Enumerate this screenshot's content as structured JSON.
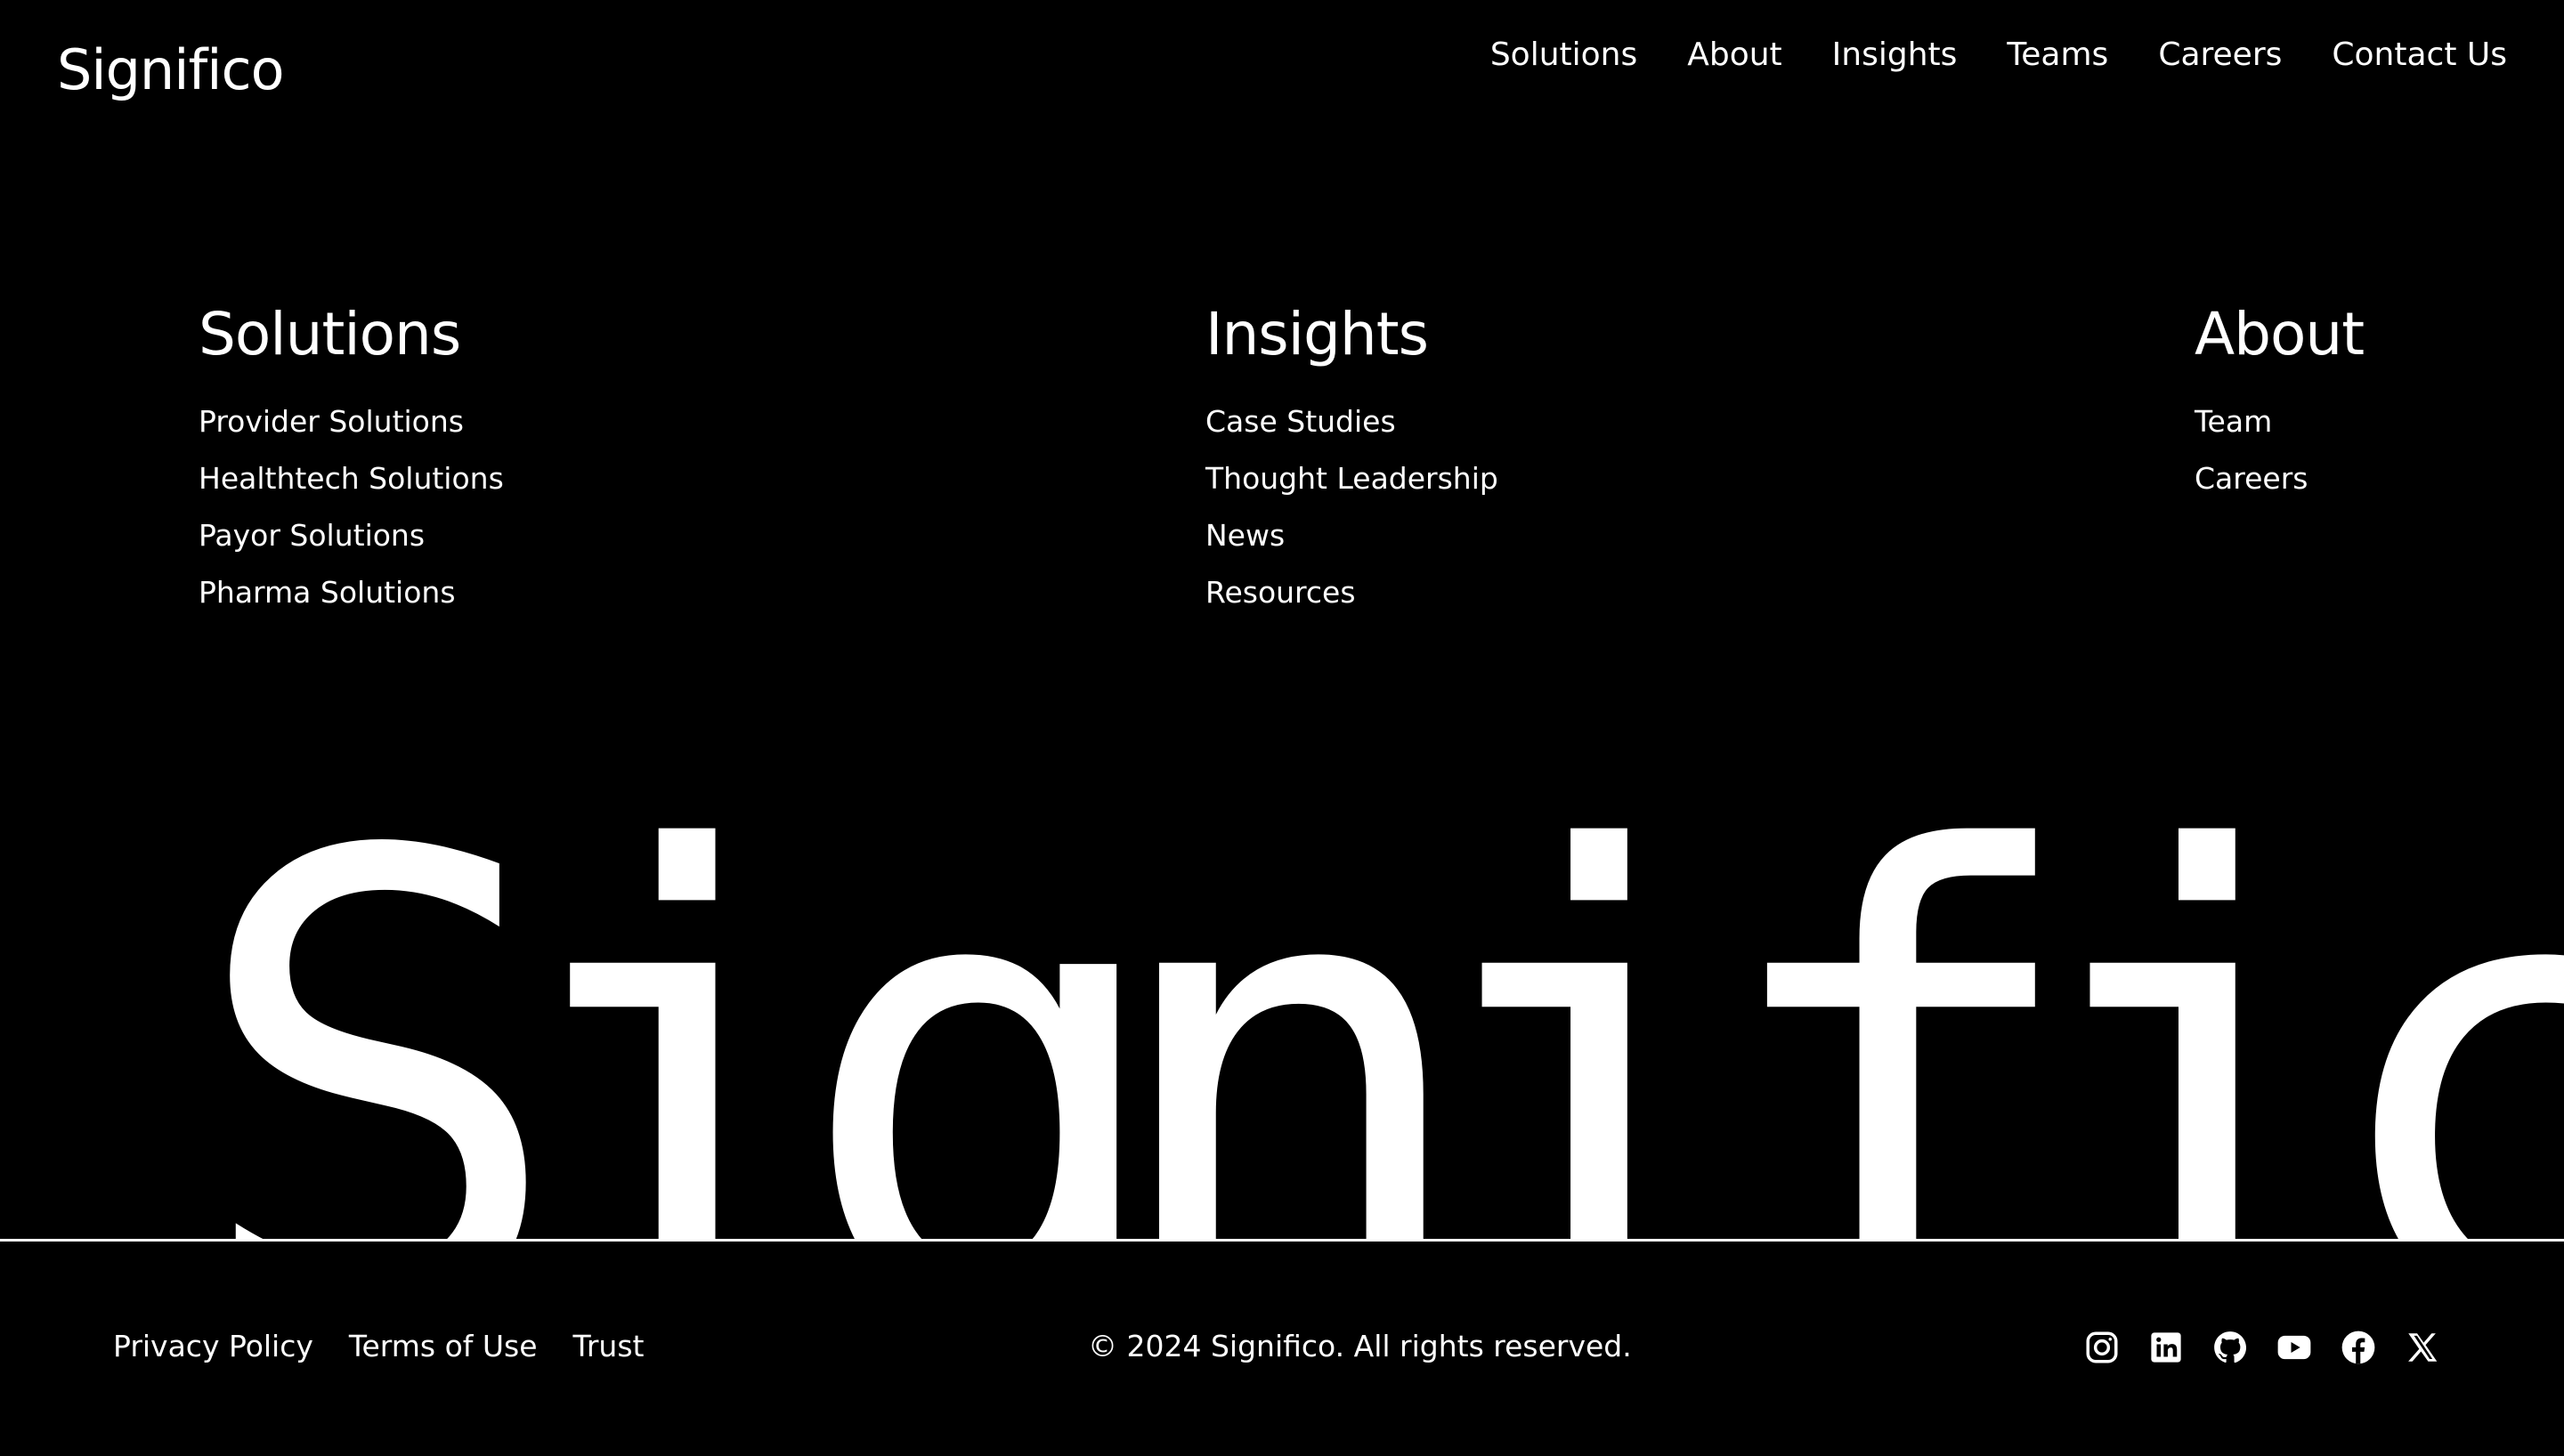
{
  "header": {
    "logo": "Significo",
    "nav": [
      "Solutions",
      "About",
      "Insights",
      "Teams",
      "Careers",
      "Contact Us"
    ]
  },
  "columns": {
    "solutions": {
      "title": "Solutions",
      "links": [
        "Provider Solutions",
        "Healthtech Solutions",
        "Payor Solutions",
        "Pharma Solutions"
      ]
    },
    "insights": {
      "title": "Insights",
      "links": [
        "Case Studies",
        "Thought Leadership",
        "News",
        "Resources"
      ]
    },
    "about": {
      "title": "About",
      "links": [
        "Team",
        "Careers"
      ]
    }
  },
  "wordmark": "Significo",
  "footer": {
    "links": [
      "Privacy Policy",
      "Terms of Use",
      "Trust"
    ],
    "copyright": "© 2024 Significo. All rights reserved.",
    "social": [
      "instagram-icon",
      "linkedin-icon",
      "github-icon",
      "youtube-icon",
      "facebook-icon",
      "x-icon"
    ]
  },
  "colors": {
    "background": "#000000",
    "foreground": "#ffffff"
  }
}
